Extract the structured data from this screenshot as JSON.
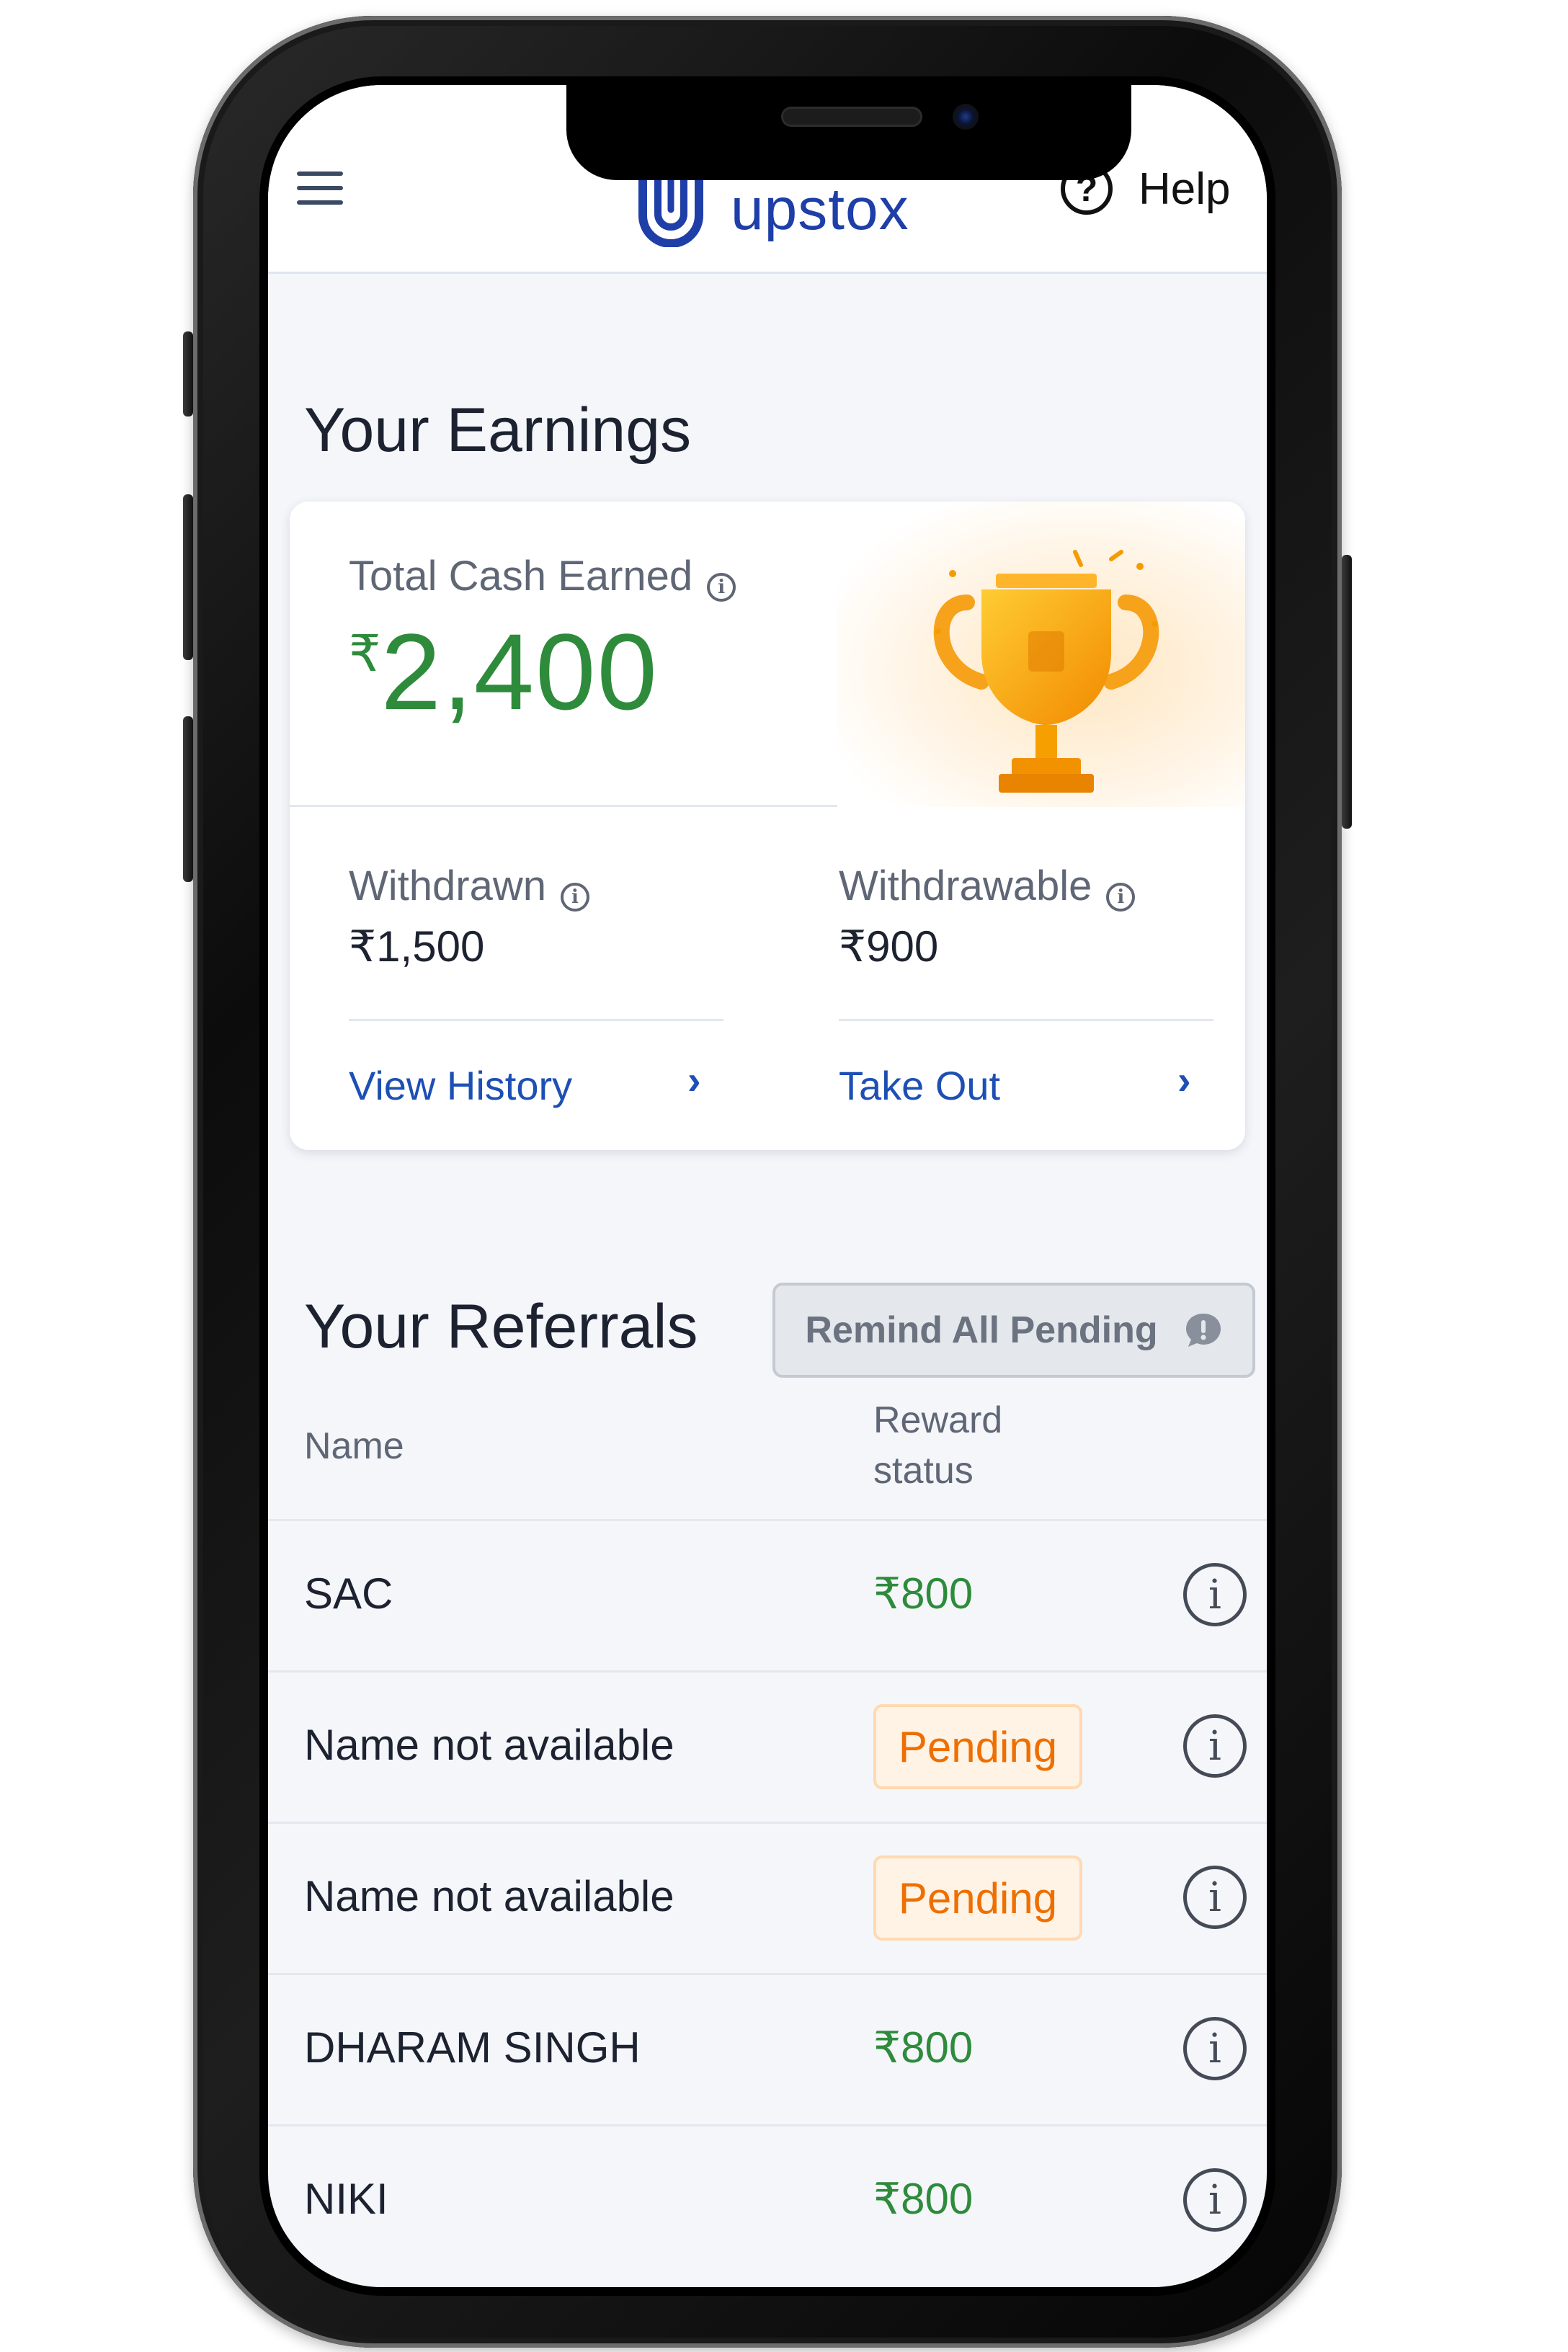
{
  "header": {
    "brand": "upstox",
    "help_label": "Help",
    "help_symbol": "?",
    "brand_color": "#1e3ea8"
  },
  "earnings": {
    "title": "Your Earnings",
    "total_label": "Total Cash Earned",
    "currency": "₹",
    "total_value": "2,400",
    "withdrawn_label": "Withdrawn",
    "withdrawn_value": "₹1,500",
    "withdrawable_label": "Withdrawable",
    "withdrawable_value": "₹900",
    "view_history": "View History",
    "take_out": "Take Out",
    "chevron": "›",
    "info_symbol": "i"
  },
  "referrals": {
    "title": "Your Referrals",
    "remind_button": "Remind All Pending",
    "col_name": "Name",
    "col_reward_line1": "Reward",
    "col_reward_line2": "status",
    "info_symbol": "i",
    "rows": [
      {
        "name": "SAC",
        "reward": "₹800",
        "status": "paid"
      },
      {
        "name": "Name not available",
        "reward": "Pending",
        "status": "pending"
      },
      {
        "name": "Name not available",
        "reward": "Pending",
        "status": "pending"
      },
      {
        "name": "DHARAM SINGH",
        "reward": "₹800",
        "status": "paid"
      },
      {
        "name": "NIKI",
        "reward": "₹800",
        "status": "paid"
      }
    ]
  },
  "colors": {
    "green_amount": "#2e8b3b",
    "link_blue": "#1d4fb4",
    "pending_orange": "#ee6f00",
    "background": "#f4f6fa"
  }
}
